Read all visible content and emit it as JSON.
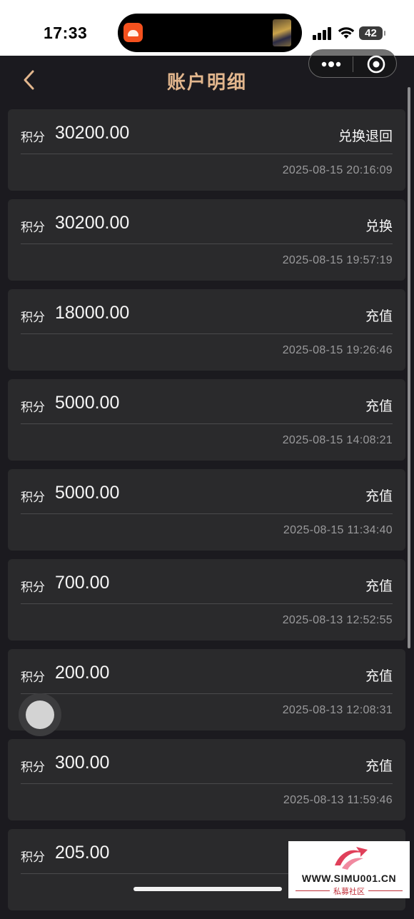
{
  "status_bar": {
    "time": "17:33",
    "battery": "42"
  },
  "nav": {
    "title": "账户明细"
  },
  "records": [
    {
      "label": "积分",
      "amount": "30200.00",
      "type": "兑换退回",
      "timestamp": "2025-08-15 20:16:09"
    },
    {
      "label": "积分",
      "amount": "30200.00",
      "type": "兑换",
      "timestamp": "2025-08-15 19:57:19"
    },
    {
      "label": "积分",
      "amount": "18000.00",
      "type": "充值",
      "timestamp": "2025-08-15 19:26:46"
    },
    {
      "label": "积分",
      "amount": "5000.00",
      "type": "充值",
      "timestamp": "2025-08-15 14:08:21"
    },
    {
      "label": "积分",
      "amount": "5000.00",
      "type": "充值",
      "timestamp": "2025-08-15 11:34:40"
    },
    {
      "label": "积分",
      "amount": "700.00",
      "type": "充值",
      "timestamp": "2025-08-13 12:52:55"
    },
    {
      "label": "积分",
      "amount": "200.00",
      "type": "充值",
      "timestamp": "2025-08-13 12:08:31"
    },
    {
      "label": "积分",
      "amount": "300.00",
      "type": "充值",
      "timestamp": "2025-08-13 11:59:46"
    },
    {
      "label": "积分",
      "amount": "205.00",
      "type": "",
      "timestamp": ""
    }
  ],
  "watermark": {
    "site": "WWW.SIMU001.CN",
    "name": "私募社区"
  }
}
